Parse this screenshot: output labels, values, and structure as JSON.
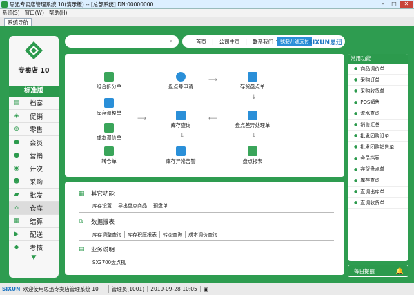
{
  "window": {
    "title": "思迅专卖店管理系统 10(演示版) -- [总部系统] DN:00000000"
  },
  "menu": [
    "系统(S)",
    "窗口(W)",
    "帮助(H)"
  ],
  "tab": "系统导航",
  "sidebar": {
    "product": "专卖店 10",
    "edition": "标准版",
    "items": [
      {
        "label": "档案",
        "icon": "clipboard-icon"
      },
      {
        "label": "促销",
        "icon": "tag-icon"
      },
      {
        "label": "零售",
        "icon": "cart-icon"
      },
      {
        "label": "会员",
        "icon": "user-icon"
      },
      {
        "label": "营销",
        "icon": "user-icon"
      },
      {
        "label": "计次",
        "icon": "bag-icon"
      },
      {
        "label": "采购",
        "icon": "person-icon"
      },
      {
        "label": "批发",
        "icon": "truck-icon"
      },
      {
        "label": "仓库",
        "icon": "warehouse-icon"
      },
      {
        "label": "结算",
        "icon": "calc-icon"
      },
      {
        "label": "配送",
        "icon": "delivery-icon"
      },
      {
        "label": "考核",
        "icon": "badge-icon"
      }
    ],
    "active_index": 8,
    "more": "▼"
  },
  "search": {
    "placeholder": ""
  },
  "toplinks": {
    "home": "首页",
    "company": "公司主页",
    "contact": "联系我们",
    "pay_button": "我要开通支付",
    "brand": "SIXUN思迅"
  },
  "flow": {
    "nodes": [
      "组合拆分单",
      "盘点号申请",
      "存货盘点单",
      "库存调整单",
      "库存查询",
      "盘点差异处理单",
      "成本调价单",
      "转仓单",
      "库存异常告警",
      "盘点报表"
    ]
  },
  "other": {
    "title": "其它功能",
    "links": [
      "库存设置",
      "导出盘点商品",
      "预盘单"
    ]
  },
  "reports": {
    "title": "数据报表",
    "links": [
      "库存调整查询",
      "库存积压报表",
      "转仓查询",
      "成本调价查询"
    ]
  },
  "business": {
    "title": "业务说明",
    "links": [
      "SX3700盘点机"
    ]
  },
  "common": {
    "title": "常用功能",
    "items": [
      "商品调价单",
      "采购订单",
      "采购收货单",
      "POS销售",
      "流水查询",
      "销售汇总",
      "批发团购订单",
      "批发团购销售单",
      "会员档案",
      "存货盘点单",
      "库存查询",
      "直调出库单",
      "直调收货单"
    ]
  },
  "reminder": "每日提醒",
  "status": {
    "brand": "SIXUN",
    "welcome": "欢迎使用思迅专卖店管理系统 10",
    "user": "管理员(1001)",
    "datetime": "2019-09-28 10:05"
  }
}
